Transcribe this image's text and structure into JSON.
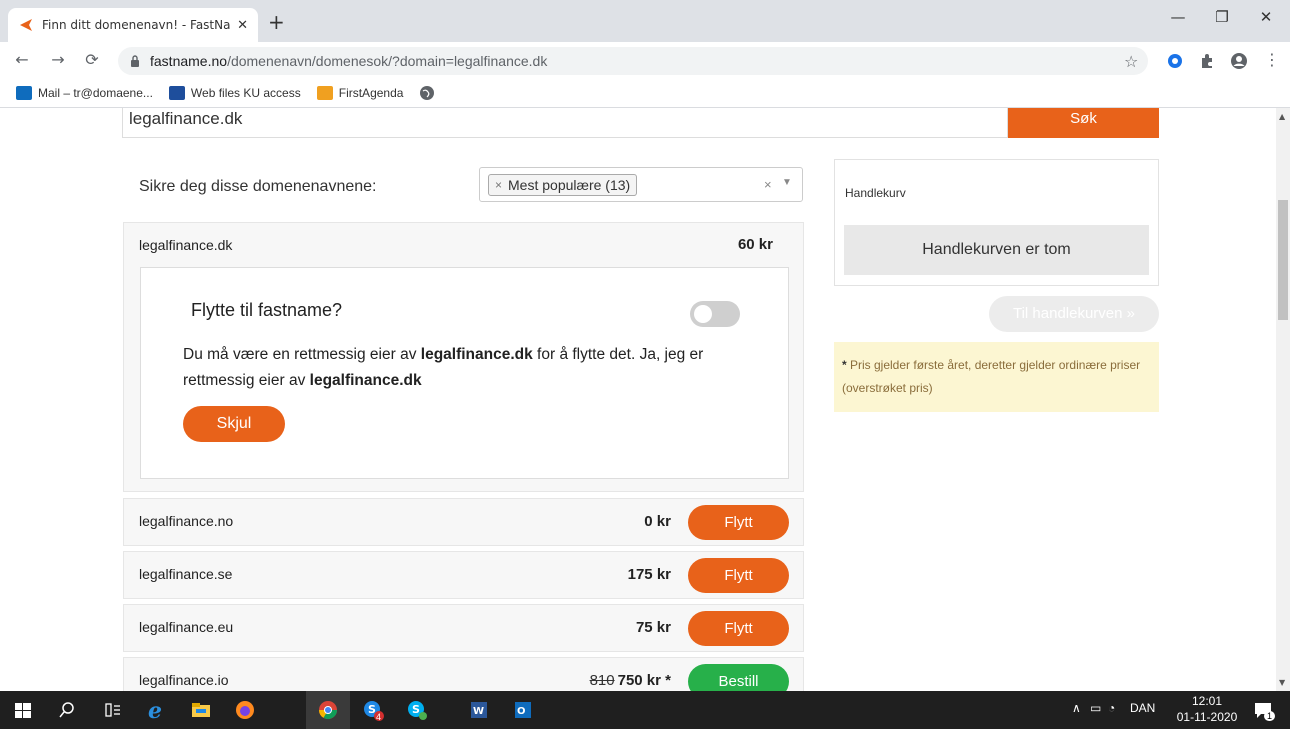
{
  "browser": {
    "tab_title": "Finn ditt domenenavn! - FastNam",
    "url_host": "fastname.no",
    "url_path": "/domenenavn/domenesok/?domain=legalfinance.dk",
    "bookmarks": [
      {
        "label": "Mail – tr@domaene...",
        "icon": "outlook-icon",
        "color": "#0f6cbd"
      },
      {
        "label": "Web files KU access",
        "icon": "ku-icon",
        "color": "#1e4e9c"
      },
      {
        "label": "FirstAgenda",
        "icon": "firstagenda-icon",
        "color": "#f0a020"
      }
    ]
  },
  "search": {
    "value": "legalfinance.dk",
    "button_label": "Søk"
  },
  "domains": {
    "section_label": "Sikre deg disse domenenavnene:",
    "filter_tag": "Mest populære (13)",
    "selected": {
      "name": "legalfinance.dk",
      "price": "60 kr",
      "transfer_title": "Flytte til fastname?",
      "transfer_text_1": "Du må være en rettmessig eier av ",
      "transfer_domain_1": "legalfinance.dk",
      "transfer_text_2": " for å flytte det. Ja, jeg er rettmessig eier av  ",
      "transfer_domain_2": "legalfinance.dk",
      "hide_label": "Skjul"
    },
    "rows": [
      {
        "name": "legalfinance.no",
        "old_price": "",
        "price": "0 kr",
        "action": "Flytt"
      },
      {
        "name": "legalfinance.se",
        "old_price": "",
        "price": "175 kr",
        "action": "Flytt"
      },
      {
        "name": "legalfinance.eu",
        "old_price": "",
        "price": "75 kr",
        "action": "Flytt"
      },
      {
        "name": "legalfinance.io",
        "old_price": "810",
        "price": "750 kr  *",
        "action": "Bestill"
      }
    ]
  },
  "cart": {
    "title": "Handlekurv",
    "empty_label": "Handlekurven er tom",
    "checkout_label": "Til handlekurven »",
    "note_asterisk": "*",
    "note_text": " Pris gjelder første året, deretter gjelder ordinære priser (overstrøket pris)"
  },
  "taskbar": {
    "language": "DAN",
    "time": "12:01",
    "date": "01-11-2020",
    "skype_badge": "4",
    "notification_count": "1"
  },
  "colors": {
    "accent_orange": "#e8621a",
    "success_green": "#27b04a",
    "note_bg": "#fcf6d2"
  }
}
